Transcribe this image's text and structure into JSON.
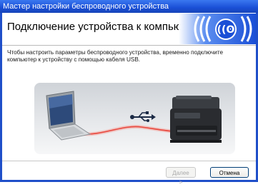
{
  "window": {
    "title": "Мастер настройки беспроводного устройства"
  },
  "header": {
    "title": "Подключение устройства к компьютеру",
    "logo_icon": "wifi-logo-icon"
  },
  "main": {
    "description": "Чтобы настроить параметры беспроводного устройства, временно подключите компьютер к устройству с помощью кабеля USB.",
    "illustration": {
      "laptop_icon": "laptop-icon",
      "usb_icon": "usb-icon",
      "printer_icon": "printer-icon",
      "cable_color": "#e8463c"
    }
  },
  "buttons": {
    "next_label": "Далее >",
    "cancel_label": "Отмена"
  },
  "colors": {
    "titlebar": "#1a4fd6",
    "logo_blue": "#1a4fd6"
  }
}
